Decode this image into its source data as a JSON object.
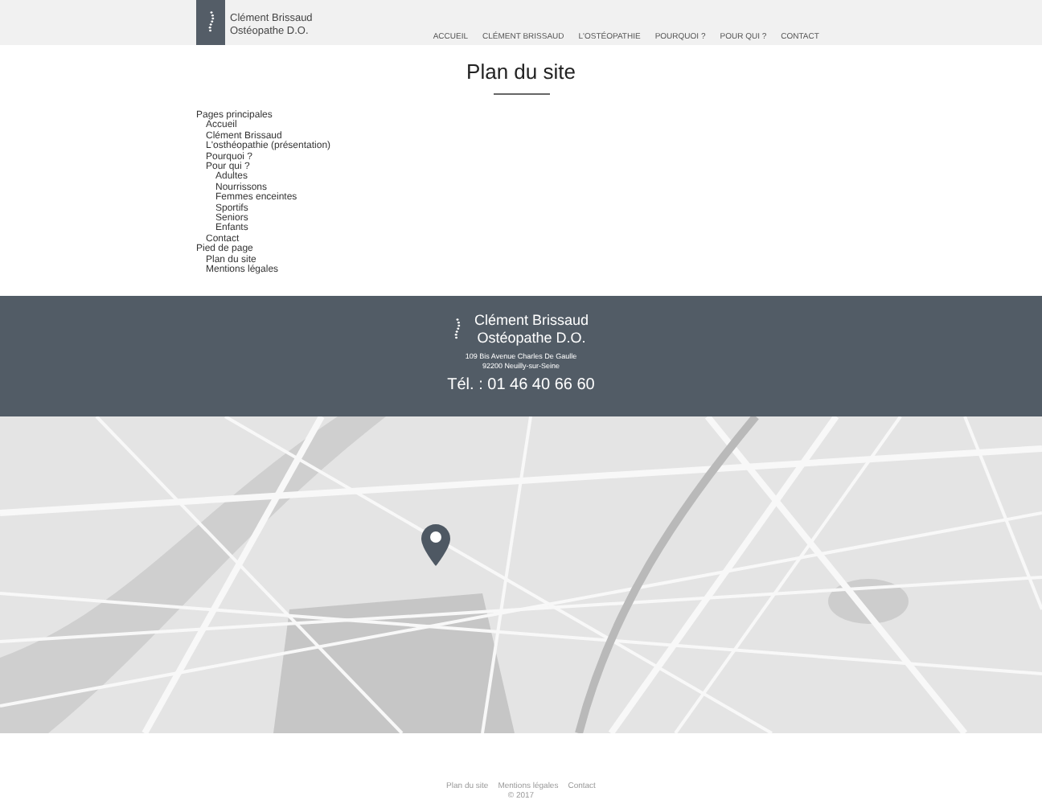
{
  "header": {
    "brand_name": "Clément Brissaud",
    "brand_title": "Ostéopathe D.O.",
    "nav": [
      {
        "label": "ACCUEIL"
      },
      {
        "label": "CLÉMENT BRISSAUD"
      },
      {
        "label": "L'OSTÉOPATHIE"
      },
      {
        "label": "POURQUOI ?"
      },
      {
        "label": "POUR QUI ?"
      },
      {
        "label": "CONTACT"
      }
    ]
  },
  "page_title": "Plan du site",
  "sitemap": [
    {
      "label": "Pages principales",
      "children": [
        {
          "label": "Accueil"
        },
        {
          "label": "Clément Brissaud"
        },
        {
          "label": "L'osthéopathie (présentation)"
        },
        {
          "label": "Pourquoi ?"
        },
        {
          "label": "Pour qui ?",
          "children": [
            {
              "label": "Adultes"
            },
            {
              "label": "Nourrissons"
            },
            {
              "label": "Femmes enceintes"
            },
            {
              "label": "Sportifs"
            },
            {
              "label": "Seniors"
            },
            {
              "label": "Enfants"
            }
          ]
        },
        {
          "label": "Contact"
        }
      ]
    },
    {
      "label": "Pied de page",
      "children": [
        {
          "label": "Plan du site"
        },
        {
          "label": "Mentions légales"
        }
      ]
    }
  ],
  "contact_band": {
    "name": "Clément Brissaud",
    "title": "Ostéopathe D.O.",
    "address_line_1": "109 Bis Avenue Charles De Gaulle",
    "address_line_2": "92200 Neuilly-sur-Seine",
    "phone": "Tél. : 01 46 40 66 60"
  },
  "footer": {
    "links": [
      {
        "label": "Plan du site"
      },
      {
        "label": "Mentions légales"
      },
      {
        "label": "Contact"
      }
    ],
    "copyright": "© 2017"
  }
}
